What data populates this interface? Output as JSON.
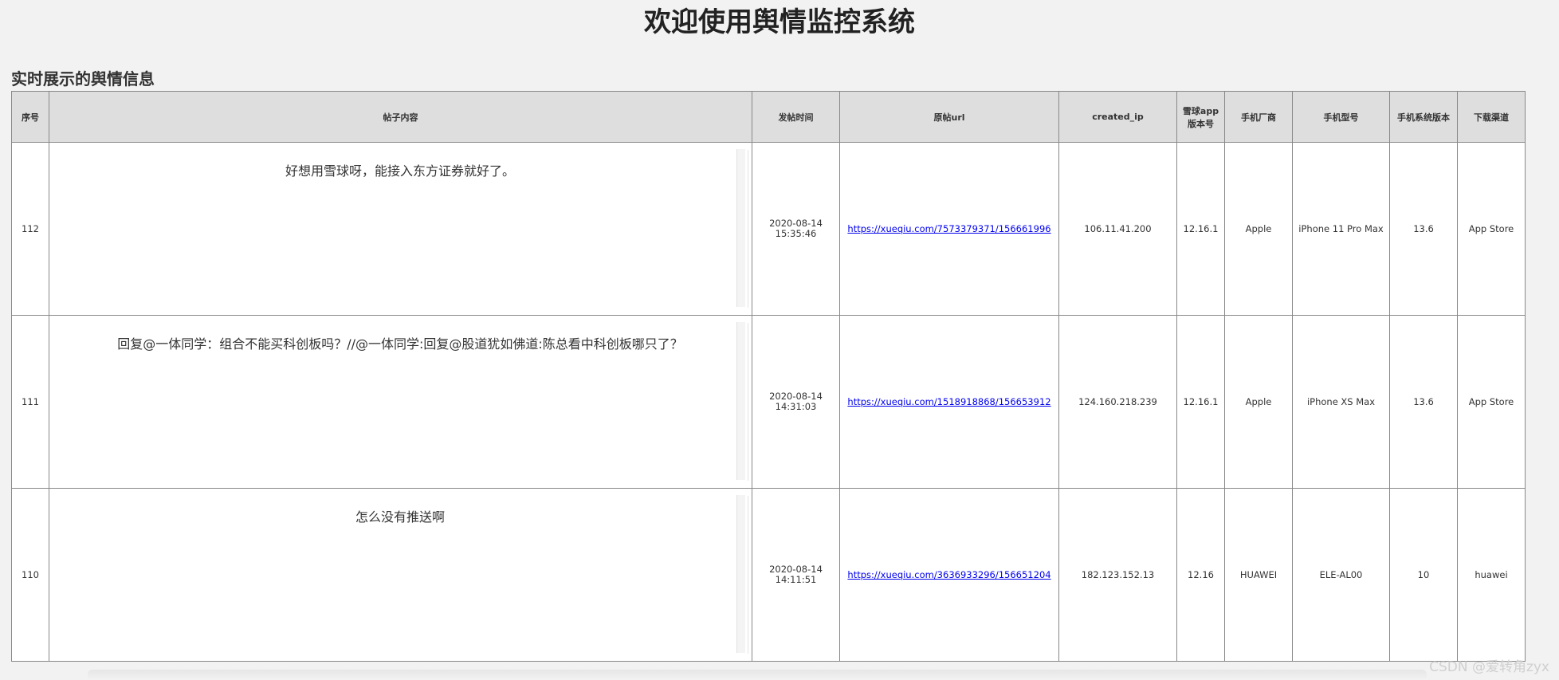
{
  "header": {
    "title": "欢迎使用舆情监控系统"
  },
  "section": {
    "title": "实时展示的舆情信息"
  },
  "table": {
    "columns": {
      "index": "序号",
      "content": "帖子内容",
      "time": "发帖时间",
      "url": "原帖url",
      "ip": "created_ip",
      "app_version": "雪球app版本号",
      "vendor": "手机厂商",
      "model": "手机型号",
      "os_version": "手机系统版本",
      "channel": "下载渠道"
    },
    "rows": [
      {
        "index": "112",
        "content": "好想用雪球呀，能接入东方证券就好了。",
        "date": "2020-08-14",
        "time": "15:35:46",
        "url": "https://xueqiu.com/7573379371/156661996",
        "ip": "106.11.41.200",
        "app_version": "12.16.1",
        "vendor": "Apple",
        "model": "iPhone 11 Pro Max",
        "os_version": "13.6",
        "channel": "App Store"
      },
      {
        "index": "111",
        "content": "回复@一体同学：组合不能买科创板吗？//@一体同学:回复@股道犹如佛道:陈总看中科创板哪只了？",
        "date": "2020-08-14",
        "time": "14:31:03",
        "url": "https://xueqiu.com/1518918868/156653912",
        "ip": "124.160.218.239",
        "app_version": "12.16.1",
        "vendor": "Apple",
        "model": "iPhone XS Max",
        "os_version": "13.6",
        "channel": "App Store"
      },
      {
        "index": "110",
        "content": "怎么没有推送啊",
        "date": "2020-08-14",
        "time": "14:11:51",
        "url": "https://xueqiu.com/3636933296/156651204",
        "ip": "182.123.152.13",
        "app_version": "12.16",
        "vendor": "HUAWEI",
        "model": "ELE-AL00",
        "os_version": "10",
        "channel": "huawei"
      }
    ]
  },
  "watermark": "CSDN @爱转角zyx"
}
